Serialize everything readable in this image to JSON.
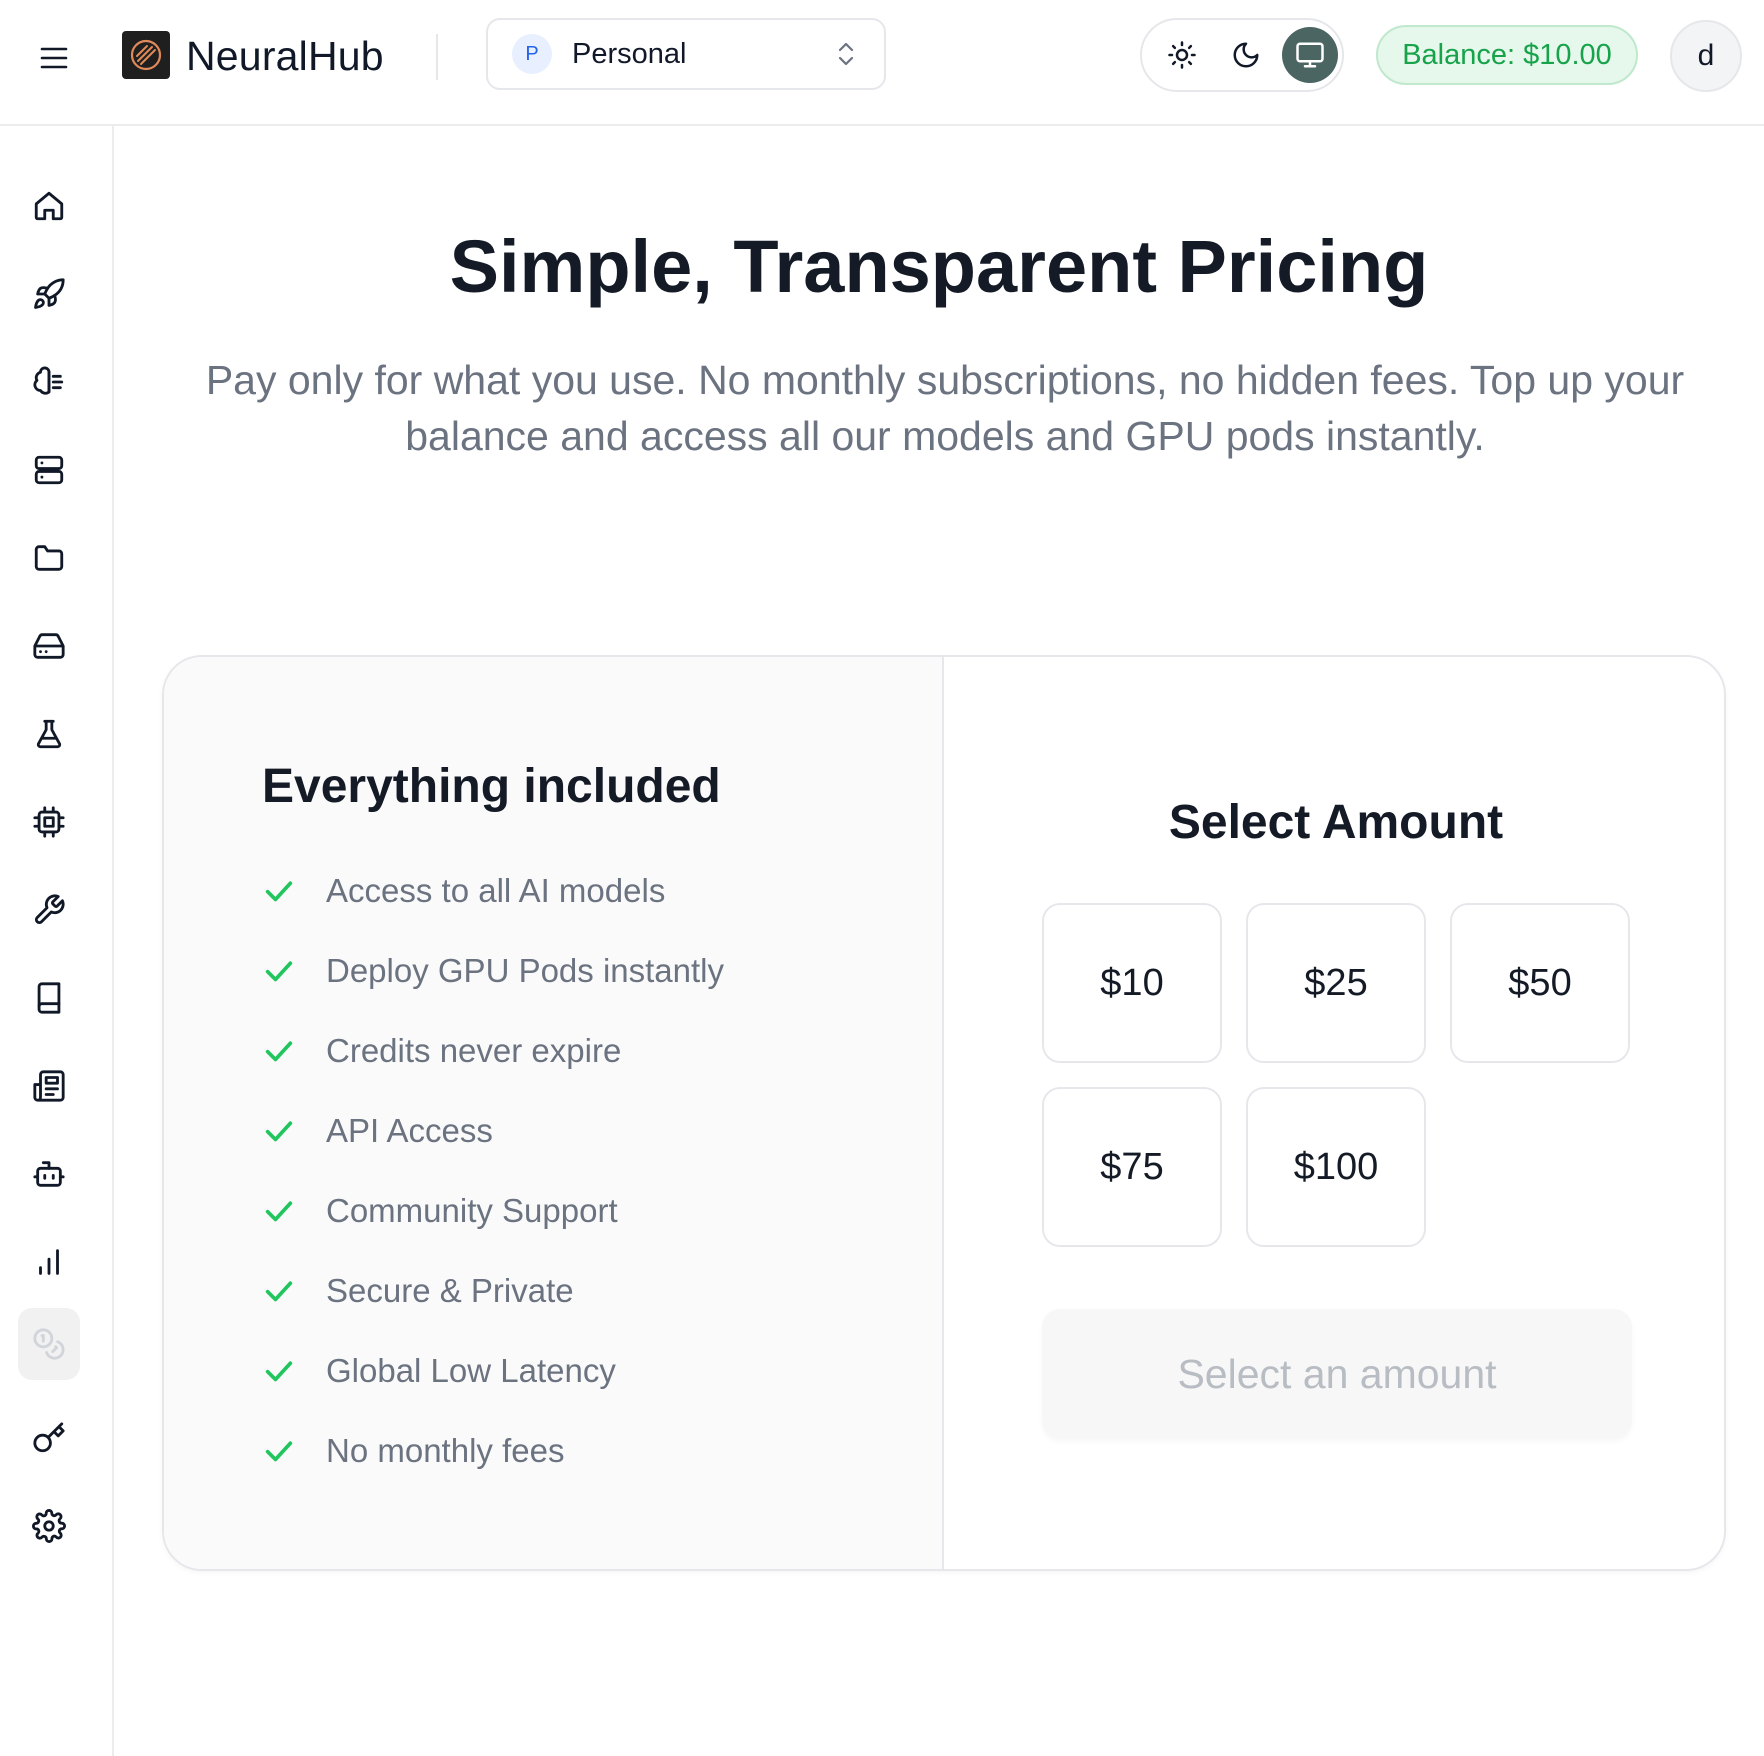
{
  "header": {
    "brand": "NeuralHub",
    "workspace": {
      "initial": "P",
      "name": "Personal"
    },
    "theme": {
      "options": [
        "light",
        "dark",
        "system"
      ],
      "active": "system"
    },
    "balance": "Balance: $10.00",
    "user_initial": "d"
  },
  "sidebar": {
    "items": [
      {
        "name": "home",
        "icon": "home-icon"
      },
      {
        "name": "deploy",
        "icon": "rocket-icon"
      },
      {
        "name": "models",
        "icon": "brain-icon"
      },
      {
        "name": "servers",
        "icon": "server-icon"
      },
      {
        "name": "files",
        "icon": "folder-icon"
      },
      {
        "name": "storage",
        "icon": "hard-drive-icon"
      },
      {
        "name": "lab",
        "icon": "flask-icon"
      },
      {
        "name": "gpu",
        "icon": "cpu-icon"
      },
      {
        "name": "tools",
        "icon": "wrench-icon"
      },
      {
        "name": "docs",
        "icon": "book-icon"
      },
      {
        "name": "news",
        "icon": "newspaper-icon"
      },
      {
        "name": "agents",
        "icon": "bot-icon"
      },
      {
        "name": "analytics",
        "icon": "bar-chart-icon"
      },
      {
        "name": "billing",
        "icon": "coins-icon",
        "active": true
      },
      {
        "name": "api-keys",
        "icon": "key-icon"
      },
      {
        "name": "settings",
        "icon": "gear-icon"
      }
    ]
  },
  "hero": {
    "title": "Simple, Transparent Pricing",
    "subtitle": "Pay only for what you use. No monthly subscriptions, no hidden fees. Top up your balance and access all our models and GPU pods instantly."
  },
  "pricing": {
    "features_title": "Everything included",
    "features": [
      "Access to all AI models",
      "Deploy GPU Pods instantly",
      "Credits never expire",
      "API Access",
      "Community Support",
      "Secure & Private",
      "Global Low Latency",
      "No monthly fees"
    ],
    "select_title": "Select Amount",
    "amounts": [
      "$10",
      "$25",
      "$50",
      "$75",
      "$100"
    ],
    "cta": "Select an amount"
  },
  "colors": {
    "accent_green": "#16a34a",
    "check_green": "#22c55e",
    "theme_active": "#4b6563",
    "text_dark": "#141a26",
    "text_muted": "#6b7280"
  }
}
